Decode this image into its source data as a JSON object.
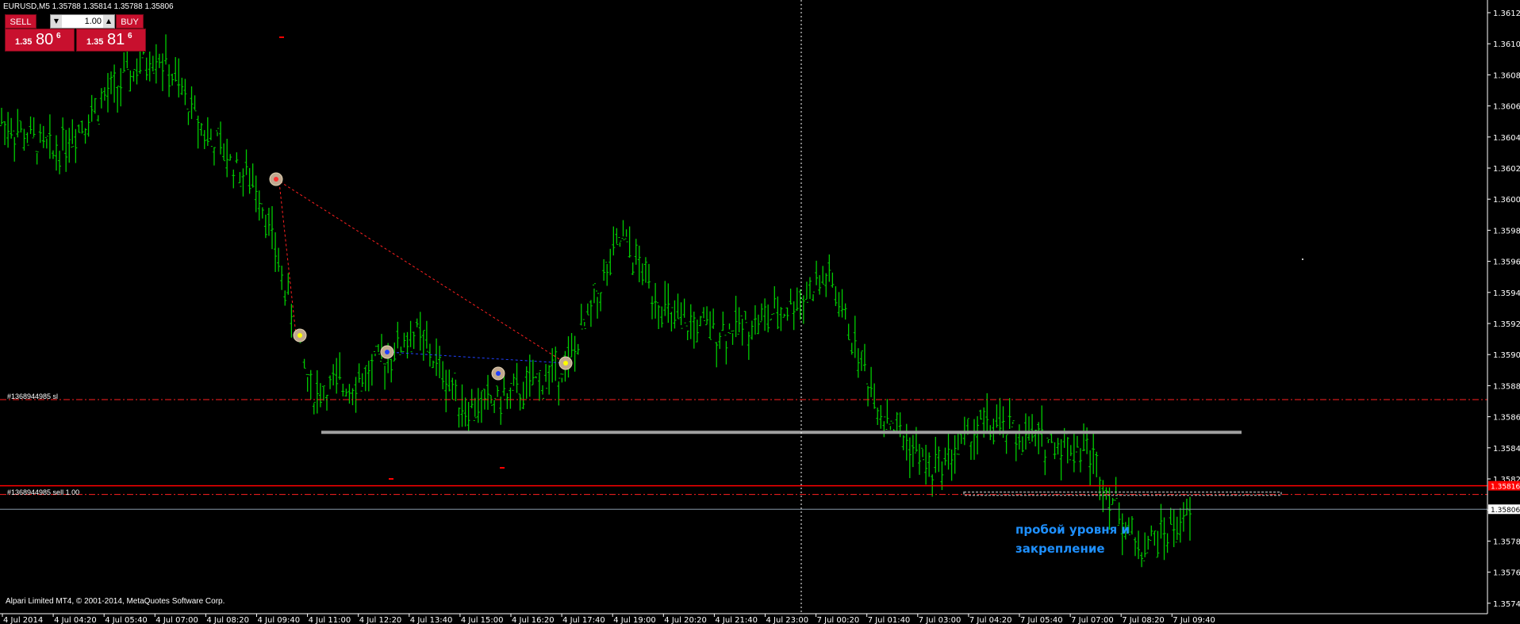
{
  "window": {
    "symbol_title": "EURUSD,M5  1.35788 1.35814 1.35788 1.35806",
    "copyright": "Alpari Limited MT4, © 2001-2014, MetaQuotes Software Corp."
  },
  "one_click": {
    "sell_label": "SELL",
    "buy_label": "BUY",
    "volume": "1.00",
    "sell_price_small": "1.35",
    "sell_price_big": "80",
    "sell_price_sup": "6",
    "buy_price_small": "1.35",
    "buy_price_big": "81",
    "buy_price_sup": "6"
  },
  "orders": {
    "sl_label": "#1368944985 sl",
    "sell_label": "#1368944985 sell 1.00"
  },
  "annotation": {
    "line1": "пробой уровня и",
    "line2": "закрепление"
  },
  "colors": {
    "background": "#000000",
    "candles": "#00cc00",
    "sl_line": "#ff2020",
    "bid_line": "#ff0000",
    "support_level": "#a0a0a0",
    "annotation": "#1e90ff",
    "trend_line": "#ff2020",
    "blue_line": "#2040ff"
  },
  "price_axis": {
    "labels": [
      "1.36125",
      "1.36105",
      "1.36085",
      "1.36065",
      "1.36045",
      "1.36025",
      "1.36005",
      "1.35985",
      "1.35965",
      "1.35945",
      "1.35925",
      "1.35905",
      "1.35885",
      "1.35865",
      "1.35845",
      "1.35825",
      "1.35805",
      "1.35785",
      "1.35765",
      "1.35745"
    ],
    "current_bid_tag": "1.35806",
    "sl_tag": "1.35816"
  },
  "time_axis": {
    "labels": [
      "4 Jul 2014",
      "4 Jul 04:20",
      "4 Jul 05:40",
      "4 Jul 07:00",
      "4 Jul 08:20",
      "4 Jul 09:40",
      "4 Jul 11:00",
      "4 Jul 12:20",
      "4 Jul 13:40",
      "4 Jul 15:00",
      "4 Jul 16:20",
      "4 Jul 17:40",
      "4 Jul 19:00",
      "4 Jul 20:20",
      "4 Jul 21:40",
      "4 Jul 23:00",
      "7 Jul 00:20",
      "7 Jul 01:40",
      "7 Jul 03:00",
      "7 Jul 04:20",
      "7 Jul 05:40",
      "7 Jul 07:00",
      "7 Jul 08:20",
      "7 Jul 09:40"
    ]
  },
  "chart_data": {
    "type": "line",
    "title": "",
    "xlabel": "",
    "ylabel": "",
    "ylim": [
      1.35735,
      1.36135
    ],
    "x": [
      "4 Jul 2014",
      "4 Jul 04:20",
      "4 Jul 05:40",
      "4 Jul 07:00",
      "4 Jul 08:20",
      "4 Jul 09:40",
      "4 Jul 11:00",
      "4 Jul 12:20",
      "4 Jul 13:40",
      "4 Jul 15:00",
      "4 Jul 16:20",
      "4 Jul 17:40",
      "4 Jul 19:00",
      "4 Jul 20:20",
      "4 Jul 21:40",
      "4 Jul 23:00",
      "7 Jul 00:20",
      "7 Jul 01:40",
      "7 Jul 03:00",
      "7 Jul 04:20",
      "7 Jul 05:40",
      "7 Jul 07:00",
      "7 Jul 08:20",
      "7 Jul 09:40"
    ],
    "series": [
      {
        "name": "",
        "values": [
          1.36055,
          1.36035,
          1.3607,
          1.361,
          1.36045,
          1.3601,
          1.3588,
          1.3589,
          1.3592,
          1.3587,
          1.3588,
          1.359,
          1.3598,
          1.35925,
          1.3592,
          1.3593,
          1.35955,
          1.3587,
          1.3583,
          1.3586,
          1.3585,
          1.35845,
          1.3578,
          1.358
        ]
      }
    ],
    "levels": {
      "sl": 1.35876,
      "support": 1.35855,
      "bid": 1.35806,
      "sell_entry": 1.35816
    }
  }
}
